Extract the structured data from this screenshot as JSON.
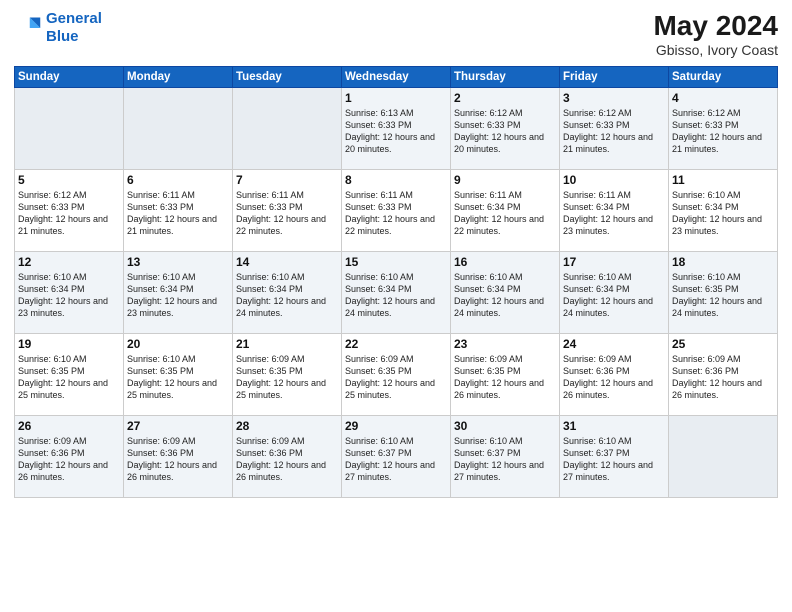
{
  "logo": {
    "line1": "General",
    "line2": "Blue"
  },
  "title": "May 2024",
  "location": "Gbisso, Ivory Coast",
  "weekdays": [
    "Sunday",
    "Monday",
    "Tuesday",
    "Wednesday",
    "Thursday",
    "Friday",
    "Saturday"
  ],
  "weeks": [
    [
      {
        "num": "",
        "empty": true
      },
      {
        "num": "",
        "empty": true
      },
      {
        "num": "",
        "empty": true
      },
      {
        "num": "1",
        "sunrise": "6:13 AM",
        "sunset": "6:33 PM",
        "daylight": "12 hours and 20 minutes."
      },
      {
        "num": "2",
        "sunrise": "6:12 AM",
        "sunset": "6:33 PM",
        "daylight": "12 hours and 20 minutes."
      },
      {
        "num": "3",
        "sunrise": "6:12 AM",
        "sunset": "6:33 PM",
        "daylight": "12 hours and 21 minutes."
      },
      {
        "num": "4",
        "sunrise": "6:12 AM",
        "sunset": "6:33 PM",
        "daylight": "12 hours and 21 minutes."
      }
    ],
    [
      {
        "num": "5",
        "sunrise": "6:12 AM",
        "sunset": "6:33 PM",
        "daylight": "12 hours and 21 minutes."
      },
      {
        "num": "6",
        "sunrise": "6:11 AM",
        "sunset": "6:33 PM",
        "daylight": "12 hours and 21 minutes."
      },
      {
        "num": "7",
        "sunrise": "6:11 AM",
        "sunset": "6:33 PM",
        "daylight": "12 hours and 22 minutes."
      },
      {
        "num": "8",
        "sunrise": "6:11 AM",
        "sunset": "6:33 PM",
        "daylight": "12 hours and 22 minutes."
      },
      {
        "num": "9",
        "sunrise": "6:11 AM",
        "sunset": "6:34 PM",
        "daylight": "12 hours and 22 minutes."
      },
      {
        "num": "10",
        "sunrise": "6:11 AM",
        "sunset": "6:34 PM",
        "daylight": "12 hours and 23 minutes."
      },
      {
        "num": "11",
        "sunrise": "6:10 AM",
        "sunset": "6:34 PM",
        "daylight": "12 hours and 23 minutes."
      }
    ],
    [
      {
        "num": "12",
        "sunrise": "6:10 AM",
        "sunset": "6:34 PM",
        "daylight": "12 hours and 23 minutes."
      },
      {
        "num": "13",
        "sunrise": "6:10 AM",
        "sunset": "6:34 PM",
        "daylight": "12 hours and 23 minutes."
      },
      {
        "num": "14",
        "sunrise": "6:10 AM",
        "sunset": "6:34 PM",
        "daylight": "12 hours and 24 minutes."
      },
      {
        "num": "15",
        "sunrise": "6:10 AM",
        "sunset": "6:34 PM",
        "daylight": "12 hours and 24 minutes."
      },
      {
        "num": "16",
        "sunrise": "6:10 AM",
        "sunset": "6:34 PM",
        "daylight": "12 hours and 24 minutes."
      },
      {
        "num": "17",
        "sunrise": "6:10 AM",
        "sunset": "6:34 PM",
        "daylight": "12 hours and 24 minutes."
      },
      {
        "num": "18",
        "sunrise": "6:10 AM",
        "sunset": "6:35 PM",
        "daylight": "12 hours and 24 minutes."
      }
    ],
    [
      {
        "num": "19",
        "sunrise": "6:10 AM",
        "sunset": "6:35 PM",
        "daylight": "12 hours and 25 minutes."
      },
      {
        "num": "20",
        "sunrise": "6:10 AM",
        "sunset": "6:35 PM",
        "daylight": "12 hours and 25 minutes."
      },
      {
        "num": "21",
        "sunrise": "6:09 AM",
        "sunset": "6:35 PM",
        "daylight": "12 hours and 25 minutes."
      },
      {
        "num": "22",
        "sunrise": "6:09 AM",
        "sunset": "6:35 PM",
        "daylight": "12 hours and 25 minutes."
      },
      {
        "num": "23",
        "sunrise": "6:09 AM",
        "sunset": "6:35 PM",
        "daylight": "12 hours and 26 minutes."
      },
      {
        "num": "24",
        "sunrise": "6:09 AM",
        "sunset": "6:36 PM",
        "daylight": "12 hours and 26 minutes."
      },
      {
        "num": "25",
        "sunrise": "6:09 AM",
        "sunset": "6:36 PM",
        "daylight": "12 hours and 26 minutes."
      }
    ],
    [
      {
        "num": "26",
        "sunrise": "6:09 AM",
        "sunset": "6:36 PM",
        "daylight": "12 hours and 26 minutes."
      },
      {
        "num": "27",
        "sunrise": "6:09 AM",
        "sunset": "6:36 PM",
        "daylight": "12 hours and 26 minutes."
      },
      {
        "num": "28",
        "sunrise": "6:09 AM",
        "sunset": "6:36 PM",
        "daylight": "12 hours and 26 minutes."
      },
      {
        "num": "29",
        "sunrise": "6:10 AM",
        "sunset": "6:37 PM",
        "daylight": "12 hours and 27 minutes."
      },
      {
        "num": "30",
        "sunrise": "6:10 AM",
        "sunset": "6:37 PM",
        "daylight": "12 hours and 27 minutes."
      },
      {
        "num": "31",
        "sunrise": "6:10 AM",
        "sunset": "6:37 PM",
        "daylight": "12 hours and 27 minutes."
      },
      {
        "num": "",
        "empty": true
      }
    ]
  ]
}
